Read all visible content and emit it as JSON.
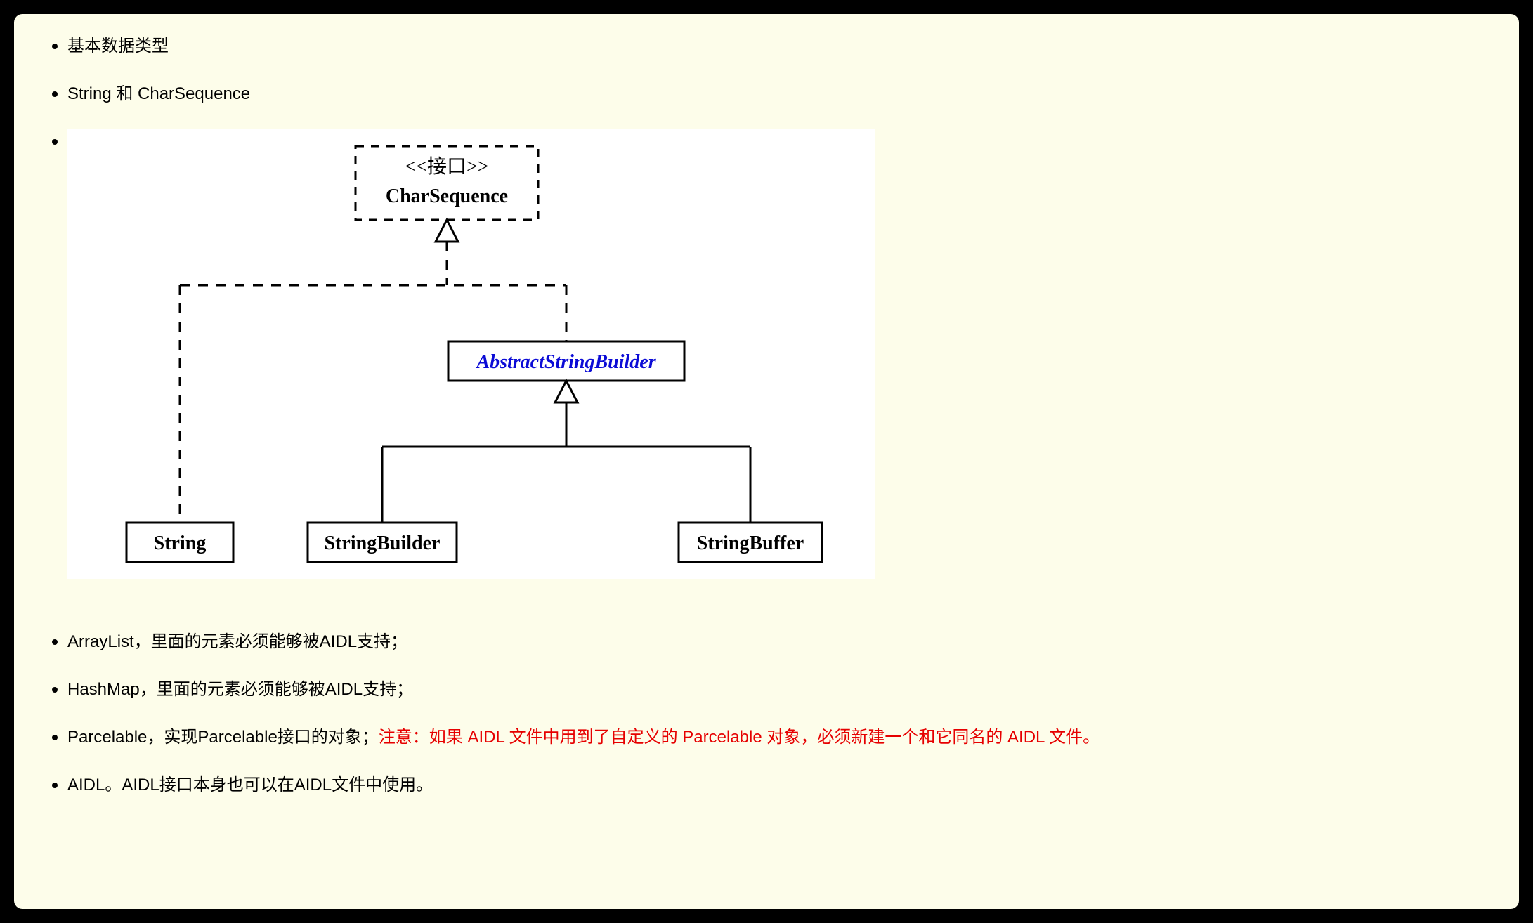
{
  "items": {
    "i1": "基本数据类型",
    "i2": "String 和 CharSequence",
    "i4": "ArrayList，里面的元素必须能够被AIDL支持；",
    "i5": "HashMap，里面的元素必须能够被AIDL支持；",
    "i6_a": "Parcelable，实现Parcelable接口的对象；",
    "i6_b": "注意：如果 AIDL 文件中用到了自定义的 Parcelable 对象，必须新建一个和它同名的 AIDL 文件。",
    "i7": "AIDL。AIDL接口本身也可以在AIDL文件中使用。"
  },
  "diagram": {
    "stereotype": "<<接口>>",
    "interface_name": "CharSequence",
    "abstract_class": "AbstractStringBuilder",
    "leaf1": "String",
    "leaf2": "StringBuilder",
    "leaf3": "StringBuffer"
  }
}
